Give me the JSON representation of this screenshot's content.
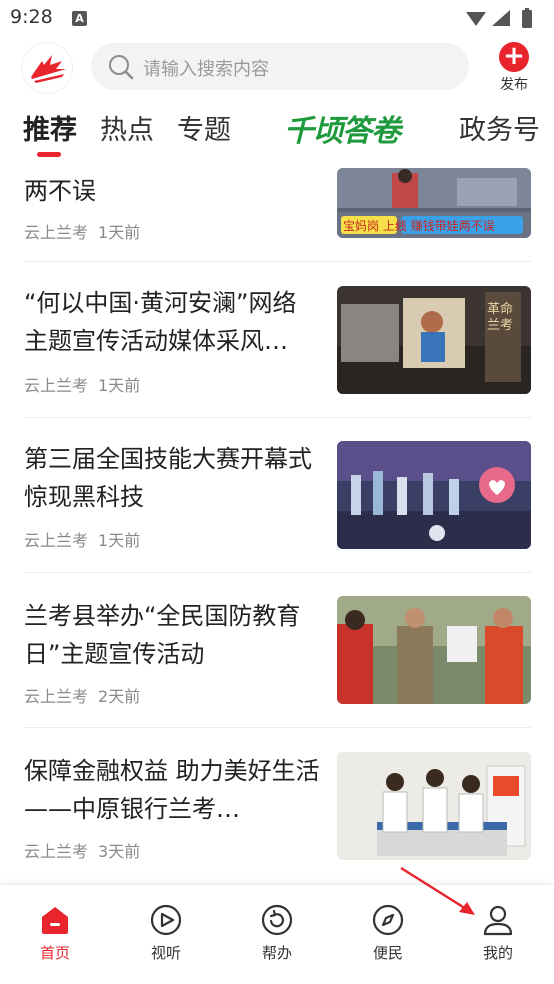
{
  "status_bar": {
    "time": "9:28",
    "indicator": "A"
  },
  "header": {
    "search_placeholder": "请输入搜索内容",
    "publish_label": "发布",
    "publish_icon": "plus-icon"
  },
  "tabs": [
    {
      "label": "推荐",
      "active": true
    },
    {
      "label": "热点",
      "active": false
    },
    {
      "label": "专题",
      "active": false
    },
    {
      "label": "千顷答卷",
      "active": false
    },
    {
      "label": "政务号",
      "active": false
    }
  ],
  "feed": [
    {
      "title": "两不误",
      "source": "云上兰考",
      "time": "1天前",
      "thumb_caption": "宝妈岗 上线 赚钱带娃两不误"
    },
    {
      "title": "“何以中国·黄河安澜”网络主题宣传活动媒体采风…",
      "source": "云上兰考",
      "time": "1天前",
      "thumb_caption": "革命兰考"
    },
    {
      "title": "第三届全国技能大赛开幕式惊现黑科技",
      "source": "云上兰考",
      "time": "1天前",
      "thumb_caption": ""
    },
    {
      "title": "兰考县举办“全民国防教育日”主题宣传活动",
      "source": "云上兰考",
      "time": "2天前",
      "thumb_caption": ""
    },
    {
      "title": "保障金融权益 助力美好生活——中原银行兰考…",
      "source": "云上兰考",
      "time": "3天前",
      "thumb_caption": ""
    }
  ],
  "bottom_nav": [
    {
      "label": "首页",
      "icon": "home-icon",
      "active": true
    },
    {
      "label": "视听",
      "icon": "play-circle-icon",
      "active": false
    },
    {
      "label": "帮办",
      "icon": "refresh-circle-icon",
      "active": false
    },
    {
      "label": "便民",
      "icon": "compass-icon",
      "active": false
    },
    {
      "label": "我的",
      "icon": "user-icon",
      "active": false
    }
  ],
  "colors": {
    "accent": "#e8242c",
    "special_tab": "#1e9a3c",
    "meta_text": "#8a8a8a"
  }
}
